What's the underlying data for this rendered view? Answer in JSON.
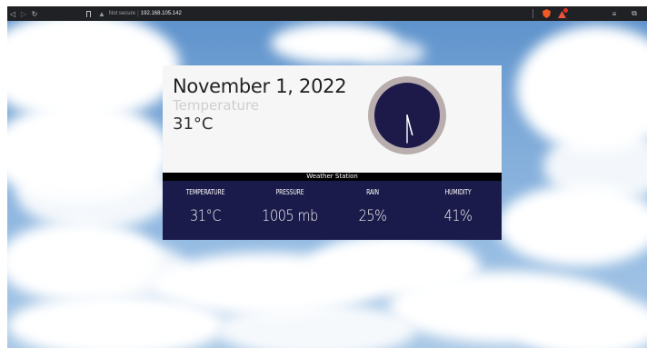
{
  "browser": {
    "security_label": "Not secure",
    "url": "192.168.105.142"
  },
  "widget": {
    "date": "November 1, 2022",
    "temperature_label": "Temperature",
    "temperature_value": "31°C",
    "clock": {
      "hour": 5,
      "minute": 30
    },
    "title": "Weather Station",
    "stats": [
      {
        "label": "TEMPERATURE",
        "value": "31°C"
      },
      {
        "label": "PRESSURE",
        "value": "1005 mb"
      },
      {
        "label": "RAIN",
        "value": "25%"
      },
      {
        "label": "HUMIDITY",
        "value": "41%"
      }
    ]
  },
  "colors": {
    "panel_bg": "#f6f6f6",
    "stats_bg": "#1b1b4b",
    "clock_face": "#1d1a4a",
    "clock_rim": "#b8aeae",
    "title_bar": "#000000"
  },
  "icons": [
    "back-arrow-icon",
    "forward-arrow-icon",
    "reload-icon",
    "bookmark-icon",
    "warning-icon",
    "brave-shield-icon",
    "brave-rewards-icon",
    "extensions-icon",
    "sidebar-icon"
  ]
}
